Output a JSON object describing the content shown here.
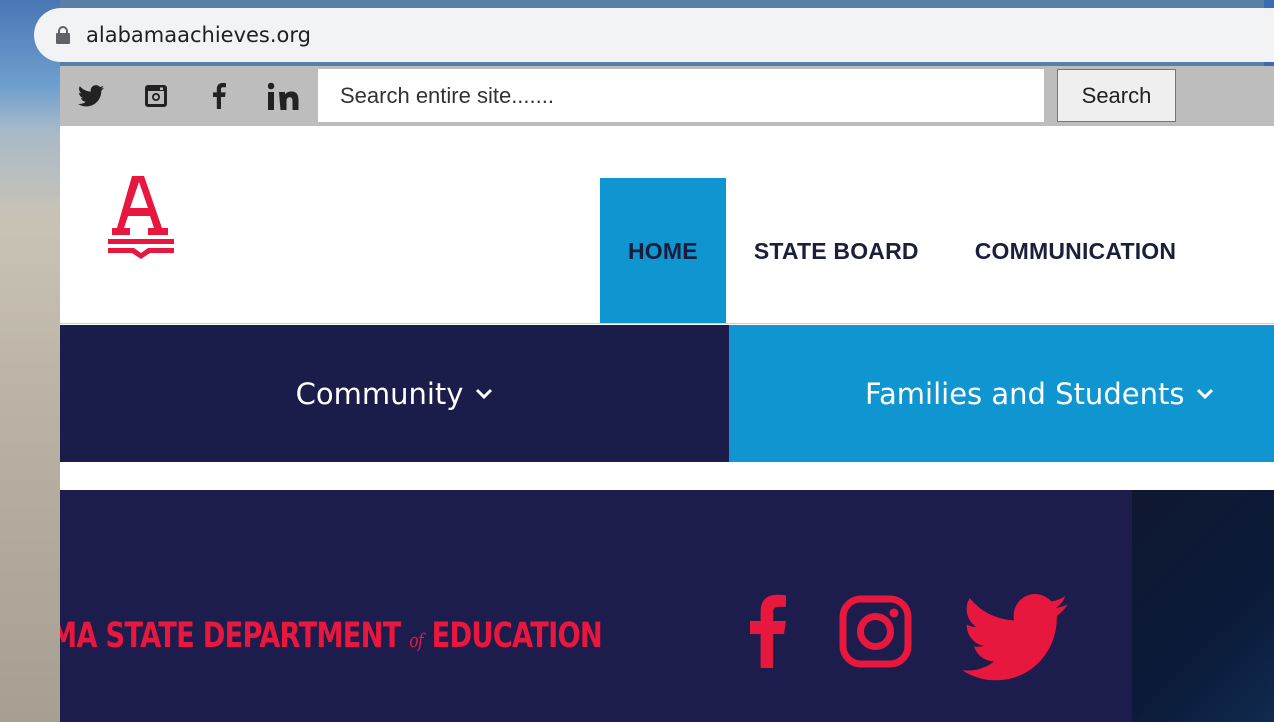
{
  "browser": {
    "url": "alabamaachieves.org"
  },
  "topbar": {
    "social_icons": [
      "twitter-icon",
      "instagram-icon",
      "facebook-icon",
      "linkedin-icon"
    ],
    "search_placeholder": "Search entire site.......",
    "search_button": "Search"
  },
  "header": {
    "logo_alt": "A",
    "nav": [
      {
        "label": "HOME",
        "active": true
      },
      {
        "label": "STATE BOARD",
        "active": false
      },
      {
        "label": "COMMUNICATION",
        "active": false
      }
    ]
  },
  "dropdowns": [
    {
      "label": "Community",
      "color": "#1a1c4a"
    },
    {
      "label": "Families and Students",
      "color": "#0f96d0"
    }
  ],
  "banner": {
    "text_1": "MA STATE  DEPARTMENT",
    "text_of": "of",
    "text_2": "EDUCATION",
    "icons": [
      "facebook-icon",
      "instagram-icon",
      "twitter-icon"
    ],
    "accent": "#e8173d"
  },
  "colors": {
    "brand_red": "#e8173d",
    "brand_blue": "#0f96d0",
    "brand_navy": "#1a1c4a"
  }
}
